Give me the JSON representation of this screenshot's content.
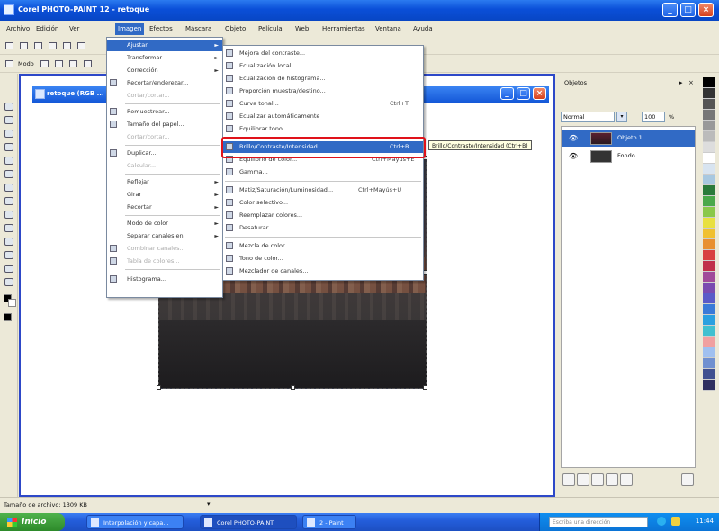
{
  "window": {
    "title": "Corel PHOTO-PAINT 12 - retoque"
  },
  "menubar": [
    "Archivo",
    "Edición",
    "Ver",
    "Imagen",
    "Efectos",
    "Máscara",
    "Objeto",
    "Película",
    "Web",
    "Herramientas",
    "Ventana",
    "Ayuda"
  ],
  "toolbar2": {
    "mode_label": "Modo"
  },
  "document": {
    "title": "retoque (RGB ..."
  },
  "imagen_menu": [
    {
      "label": "Ajustar",
      "arrow": "►",
      "highlighted": true
    },
    {
      "label": "Transformar",
      "arrow": "►"
    },
    {
      "label": "Corrección",
      "arrow": "►"
    },
    {
      "label": "Recortar/enderezar..."
    },
    {
      "label": "Cortar/cortar..."
    },
    {
      "label": "Remuestrear..."
    },
    {
      "label": "Tamaño del papel..."
    },
    {
      "label": "Cortar/cortar..."
    },
    {
      "label": "Duplicar..."
    },
    {
      "label": "Calcular..."
    },
    {
      "label": "Reflejar",
      "arrow": "►"
    },
    {
      "label": "Girar",
      "arrow": "►"
    },
    {
      "label": "Recortar",
      "arrow": "►"
    },
    {
      "label": "Modo de color",
      "arrow": "►"
    },
    {
      "label": "Separar canales en",
      "arrow": "►"
    },
    {
      "label": "Combinar canales..."
    },
    {
      "label": "Tabla de colores..."
    },
    {
      "label": "Histograma..."
    }
  ],
  "ajustar_menu": [
    {
      "label": "Mejora del contraste..."
    },
    {
      "label": "Ecualización local..."
    },
    {
      "label": "Ecualización de histograma..."
    },
    {
      "label": "Proporción muestra/destino..."
    },
    {
      "label": "Curva tonal...",
      "shortcut": "Ctrl+T"
    },
    {
      "label": "Ecualizar automáticamente"
    },
    {
      "label": "Equilibrar tono"
    },
    {
      "label": "Brillo/Contraste/Intensidad...",
      "shortcut": "Ctrl+B",
      "highlighted": true
    },
    {
      "label": "Equilibrio de color...",
      "shortcut": "Ctrl+Mayús+E"
    },
    {
      "label": "Gamma..."
    },
    {
      "label": "Matiz/Saturación/Luminosidad...",
      "shortcut": "Ctrl+Mayús+U"
    },
    {
      "label": "Color selectivo..."
    },
    {
      "label": "Reemplazar colores..."
    },
    {
      "label": "Desaturar"
    },
    {
      "label": "Mezcla de color..."
    },
    {
      "label": "Tono de color..."
    },
    {
      "label": "Mezclador de canales..."
    }
  ],
  "tooltip": "Brillo/Contraste/Intensidad (Ctrl+B)",
  "docker": {
    "title": "Objetos",
    "blend_mode": "Normal",
    "opacity": "100",
    "opacity_unit": "%",
    "objects": [
      {
        "name": "Objeto 1",
        "selected": true
      },
      {
        "name": "Fondo",
        "selected": false
      }
    ]
  },
  "status": {
    "text": "Tamaño de archivo: 1309 KB"
  },
  "taskbar": {
    "start": "Inicio",
    "tasks": [
      "Interpolación y capa...",
      "Corel PHOTO-PAINT",
      "2 - Paint"
    ],
    "search_placeholder": "Escriba una dirección",
    "clock": "11:44"
  },
  "colors": {
    "accent": "#316ac5",
    "highlight_box": "#e0121a",
    "title_blue": "#0a4fd8"
  }
}
